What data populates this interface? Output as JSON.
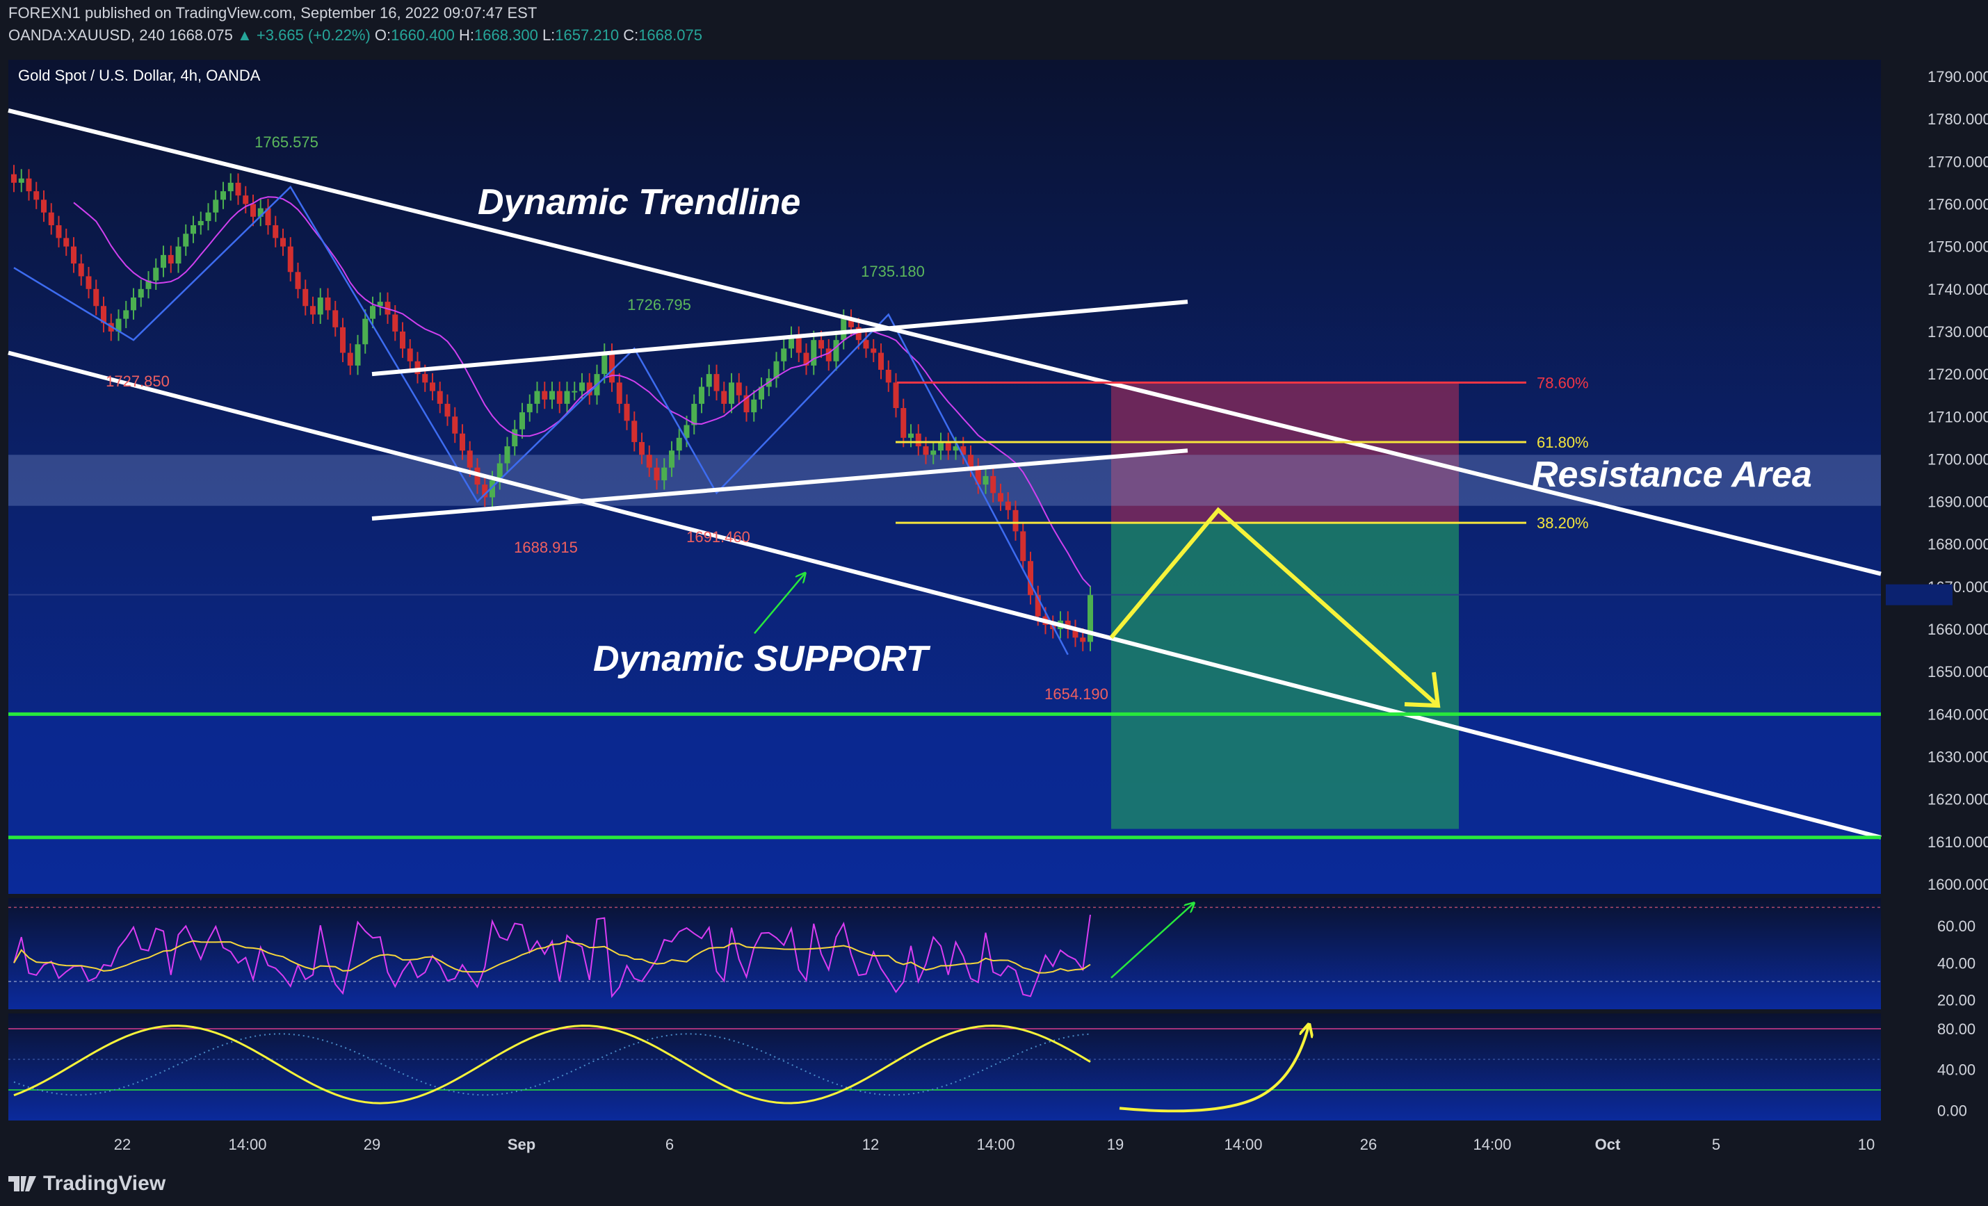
{
  "header": {
    "line1": "FOREXN1 published on TradingView.com, September 16, 2022 09:07:47 EST",
    "symbol": "OANDA:XAUUSD, 240",
    "price": "1668.075",
    "change": "+3.665 (+0.22%)",
    "o_label": "O:",
    "o_val": "1660.400",
    "h_label": "H:",
    "h_val": "1668.300",
    "l_label": "L:",
    "l_val": "1657.210",
    "c_label": "C:",
    "c_val": "1668.075"
  },
  "brand": "TradingView",
  "colors": {
    "bg": "#131722",
    "up": "#26a69a",
    "down": "#ef5350",
    "candle_up": "#4caf50",
    "candle_down": "#d32f2f",
    "trend": "#ffffff",
    "zigzag": "#3d6cf0",
    "ma": "#d040f0",
    "fib_red": "#f23645",
    "fib_yellow": "#f5e53c",
    "support_green": "#28e83c",
    "rsi": "#d93cf2",
    "rsi_ma": "#f5d63c",
    "stoch": "#f7f33a"
  },
  "chart_data": {
    "type": "candlestick",
    "title": "Gold Spot / U.S. Dollar, 4h, OANDA",
    "ylim": [
      1600,
      1790
    ],
    "y_ticks": [
      "1790.000",
      "1780.000",
      "1770.000",
      "1760.000",
      "1750.000",
      "1740.000",
      "1730.000",
      "1720.000",
      "1710.000",
      "1700.000",
      "1690.000",
      "1680.000",
      "1670.000",
      "1660.000",
      "1650.000",
      "1640.000",
      "1630.000",
      "1620.000",
      "1610.000",
      "1600.000"
    ],
    "x_ticks": [
      "22",
      "14:00",
      "29",
      "Sep",
      "6",
      "12",
      "14:00",
      "19",
      "14:00",
      "26",
      "14:00",
      "Oct",
      "5",
      "10"
    ],
    "last_price": 1668.075,
    "close_series": [
      1765,
      1766,
      1763,
      1761,
      1758,
      1755,
      1752,
      1750,
      1746,
      1743,
      1740,
      1736,
      1732,
      1730,
      1733,
      1735,
      1738,
      1740,
      1742,
      1745,
      1748,
      1746,
      1750,
      1753,
      1755,
      1756,
      1758,
      1761,
      1763,
      1765,
      1762,
      1760,
      1757,
      1759,
      1755,
      1752,
      1750,
      1744,
      1740,
      1736,
      1734,
      1738,
      1735,
      1731,
      1725,
      1722,
      1727,
      1733,
      1736,
      1737,
      1734,
      1730,
      1726,
      1723,
      1720,
      1718,
      1716,
      1713,
      1710,
      1706,
      1702,
      1698,
      1694,
      1691,
      1695,
      1699,
      1703,
      1707,
      1711,
      1713,
      1716,
      1714,
      1716,
      1713,
      1716,
      1716,
      1718,
      1715,
      1720,
      1725,
      1718,
      1713,
      1709,
      1704,
      1701,
      1698,
      1695,
      1698,
      1702,
      1705,
      1708,
      1713,
      1717,
      1720,
      1716,
      1713,
      1718,
      1715,
      1711,
      1714,
      1717,
      1719,
      1723,
      1726,
      1729,
      1725,
      1722,
      1728,
      1726,
      1723,
      1728,
      1733,
      1731,
      1728,
      1726,
      1725,
      1721,
      1718,
      1712,
      1705,
      1706,
      1703,
      1701,
      1702,
      1704,
      1702,
      1703,
      1701,
      1698,
      1694,
      1696,
      1692,
      1690,
      1688,
      1683,
      1676,
      1668,
      1663,
      1661,
      1660,
      1662,
      1660,
      1658,
      1657,
      1668
    ],
    "annotations": {
      "pivots": [
        {
          "label": "1765.575",
          "type": "high"
        },
        {
          "label": "1727.850",
          "type": "low"
        },
        {
          "label": "1726.795",
          "type": "high"
        },
        {
          "label": "1688.915",
          "type": "low"
        },
        {
          "label": "1691.460",
          "type": "low"
        },
        {
          "label": "1735.180",
          "type": "high"
        },
        {
          "label": "1654.190",
          "type": "low"
        }
      ],
      "fib_levels": [
        {
          "label": "78.60%",
          "price": 1718
        },
        {
          "label": "61.80%",
          "price": 1704
        },
        {
          "label": "38.20%",
          "price": 1685
        }
      ],
      "texts": [
        "Dynamic Trendline",
        "Dynamic SUPPORT",
        "Resistance Area"
      ],
      "resistance_zone": [
        1689,
        1701
      ],
      "support_levels": [
        1640,
        1611
      ],
      "trade_box": {
        "stop_top": 1718,
        "entry": 1685,
        "target": 1613
      }
    }
  },
  "rsi_panel": {
    "y_ticks": [
      "60.00",
      "40.00",
      "20.00"
    ],
    "ylim": [
      15,
      75
    ]
  },
  "stoch_panel": {
    "y_ticks": [
      "80.00",
      "40.00",
      "0.00"
    ],
    "ylim": [
      -10,
      95
    ]
  }
}
